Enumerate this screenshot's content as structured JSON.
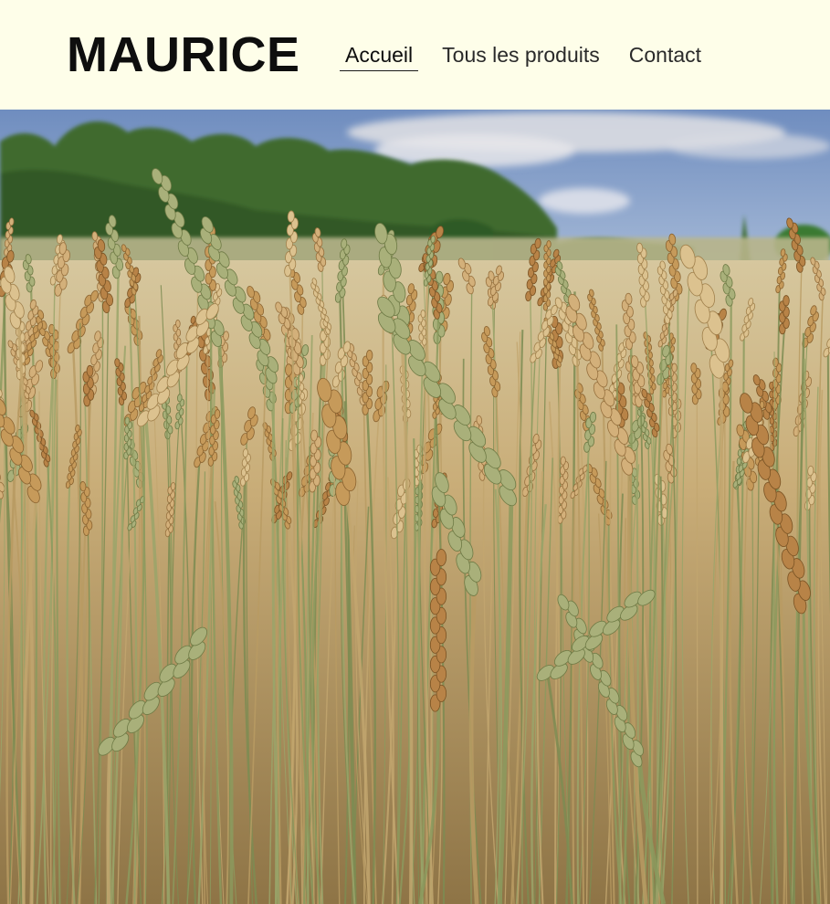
{
  "header": {
    "logo_text": "MAURICE",
    "nav": [
      {
        "label": "Accueil",
        "active": true
      },
      {
        "label": "Tous les produits",
        "active": false
      },
      {
        "label": "Contact",
        "active": false
      }
    ]
  },
  "hero": {
    "image_subject": "wheat-field-photo",
    "colors": {
      "sky": "#7e9ac6",
      "clouds": "#e2e3e6",
      "trees": "#3f6a2e",
      "field": "#cdb98b",
      "wheat": "#c49a5e",
      "stalk": "#7f8f57"
    }
  },
  "theme": {
    "background": "#fefee9",
    "text": "#0e0e0e"
  }
}
